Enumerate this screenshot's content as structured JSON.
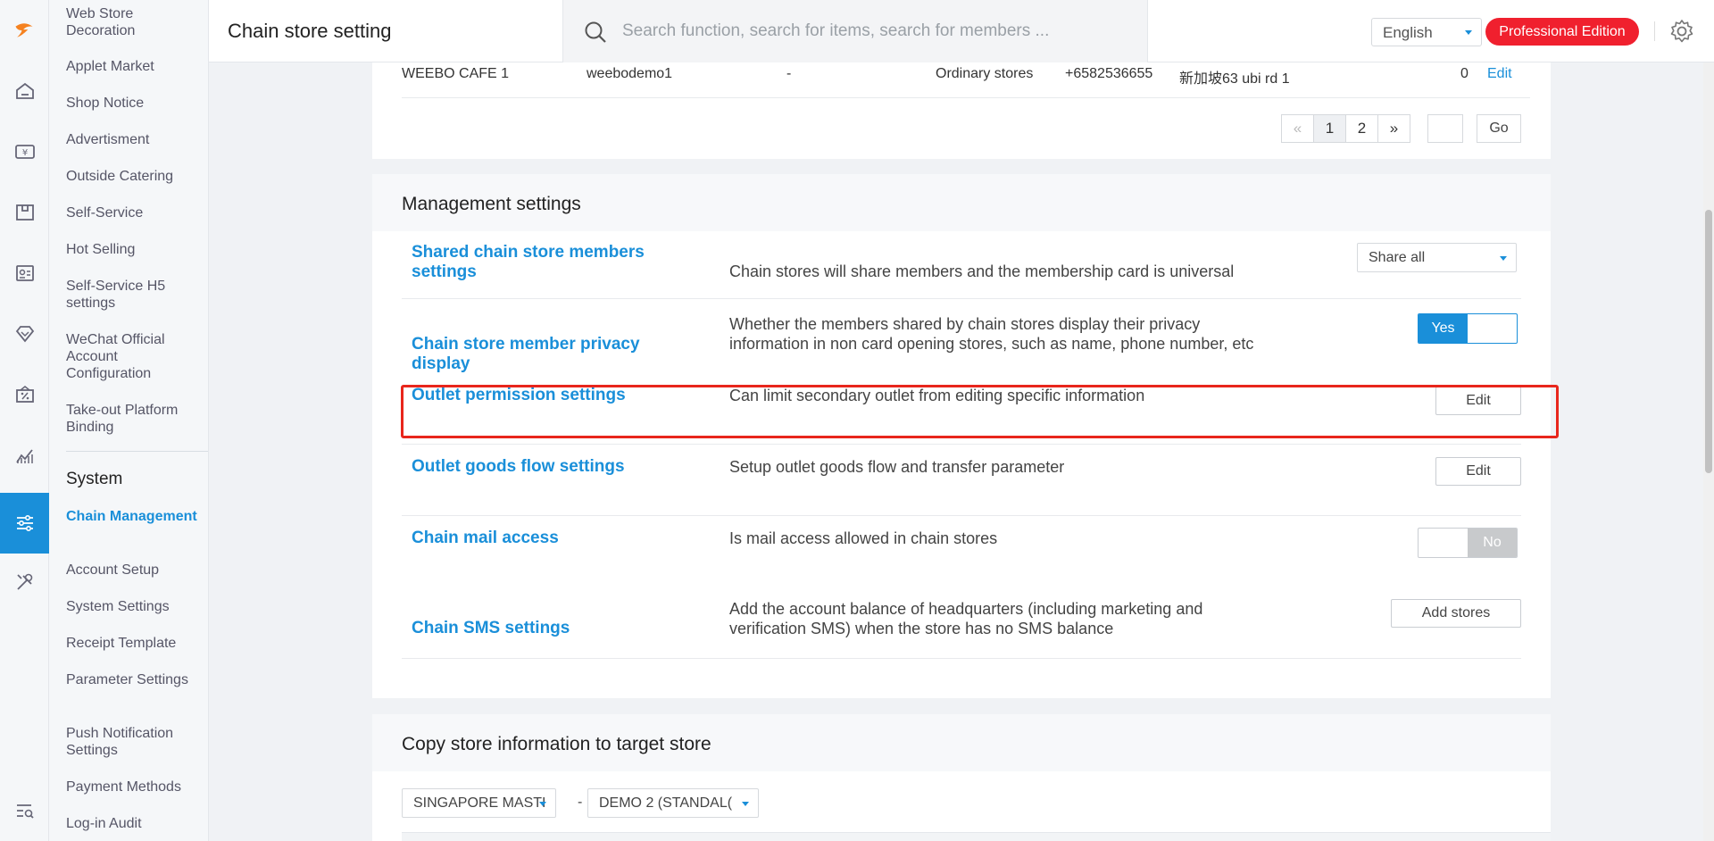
{
  "window": {
    "page_title": "Chain store setting"
  },
  "search": {
    "placeholder": "Search function, search for items, search for members ..."
  },
  "header": {
    "language": "English",
    "edition_badge": "Professional Edition"
  },
  "rail_icons": [
    "home-icon",
    "yen-cashier-icon",
    "store-icon",
    "member-card-icon",
    "diamond-icon",
    "discount-icon",
    "chart-icon",
    "settings-sliders-icon",
    "tools-icon",
    "search-list-icon"
  ],
  "menu": {
    "items": [
      {
        "label": "Web Store Decoration"
      },
      {
        "label": "Applet Market"
      },
      {
        "label": "Shop Notice"
      },
      {
        "label": "Advertisment"
      },
      {
        "label": "Outside Catering"
      },
      {
        "label": "Self-Service"
      },
      {
        "label": "Hot Selling"
      },
      {
        "label": "Self-Service H5 settings"
      },
      {
        "label": "WeChat Official Account Configuration"
      },
      {
        "label": "Take-out Platform Binding"
      }
    ],
    "section_title": "System",
    "system_items": [
      {
        "label": "Chain Management",
        "active": true
      },
      {
        "label": "Account Setup"
      },
      {
        "label": "System Settings"
      },
      {
        "label": "Receipt Template"
      },
      {
        "label": "Parameter Settings"
      },
      {
        "label": "Push Notification Settings"
      },
      {
        "label": "Payment Methods"
      },
      {
        "label": "Log-in Audit"
      }
    ]
  },
  "store_table": {
    "row": {
      "name": "WEEBO CAFE 1",
      "account": "weebodemo1",
      "dash": "-",
      "type": "Ordinary stores",
      "phone": "+6582536655",
      "address": "新加坡63 ubi rd 1",
      "count": "0",
      "action": "Edit"
    },
    "pagination": {
      "prev": "«",
      "pages": [
        "1",
        "2"
      ],
      "current": "1",
      "next": "»",
      "go": "Go"
    }
  },
  "management": {
    "title": "Management settings",
    "rows": [
      {
        "name": "Shared chain store members settings",
        "desc": "Chain stores will share members and the membership card is universal",
        "control": "Share all"
      },
      {
        "name": "Chain store member privacy display",
        "desc": "Whether the members shared by chain stores display their privacy information in non card opening stores, such as name, phone number, etc",
        "control": "Yes"
      },
      {
        "name": "Outlet permission settings",
        "desc": "Can limit secondary outlet from editing specific information",
        "control": "Edit"
      },
      {
        "name": "Outlet goods flow settings",
        "desc": "Setup outlet goods flow and transfer parameter",
        "control": "Edit"
      },
      {
        "name": "Chain mail access",
        "desc": "Is mail access allowed in chain stores",
        "control": "No"
      },
      {
        "name": "Chain SMS settings",
        "desc": "Add the account balance of headquarters (including marketing and verification SMS) when the store has no SMS balance",
        "control": "Add stores"
      }
    ]
  },
  "copy_section": {
    "title": "Copy store information to target store",
    "source_store": "SINGAPORE MASTI",
    "separator": "-",
    "target_store": "DEMO 2 (STANDAL("
  },
  "colors": {
    "accent": "#1a8fd9",
    "badge": "#f0202e",
    "highlight": "#e8261c"
  }
}
